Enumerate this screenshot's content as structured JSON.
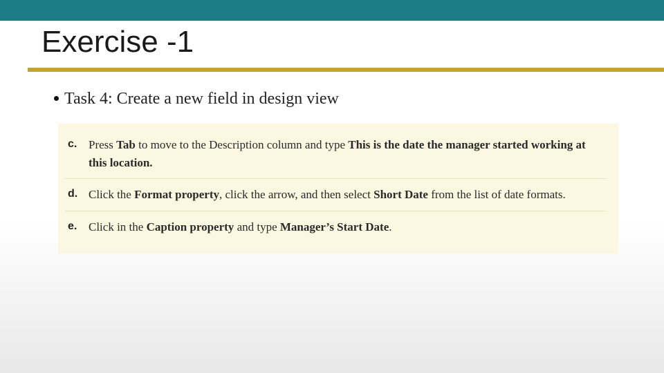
{
  "header": {
    "title": "Exercise -1"
  },
  "content": {
    "task_bullet": "Task 4: Create a new field in design view",
    "steps": [
      {
        "letter": "c.",
        "parts": [
          {
            "t": "Press ",
            "b": false
          },
          {
            "t": "Tab",
            "b": true
          },
          {
            "t": " to move to the Description column and type ",
            "b": false
          },
          {
            "t": "This is the date the manager started working at this location.",
            "b": true
          }
        ]
      },
      {
        "letter": "d.",
        "parts": [
          {
            "t": "Click the ",
            "b": false
          },
          {
            "t": "Format property",
            "b": true
          },
          {
            "t": ", click the arrow, and then select ",
            "b": false
          },
          {
            "t": "Short Date",
            "b": true
          },
          {
            "t": " from the list of date formats.",
            "b": false
          }
        ]
      },
      {
        "letter": "e.",
        "parts": [
          {
            "t": "Click in the ",
            "b": false
          },
          {
            "t": "Caption property",
            "b": true
          },
          {
            "t": " and type ",
            "b": false
          },
          {
            "t": "Manager’s Start Date",
            "b": true
          },
          {
            "t": ".",
            "b": false
          }
        ]
      }
    ]
  }
}
